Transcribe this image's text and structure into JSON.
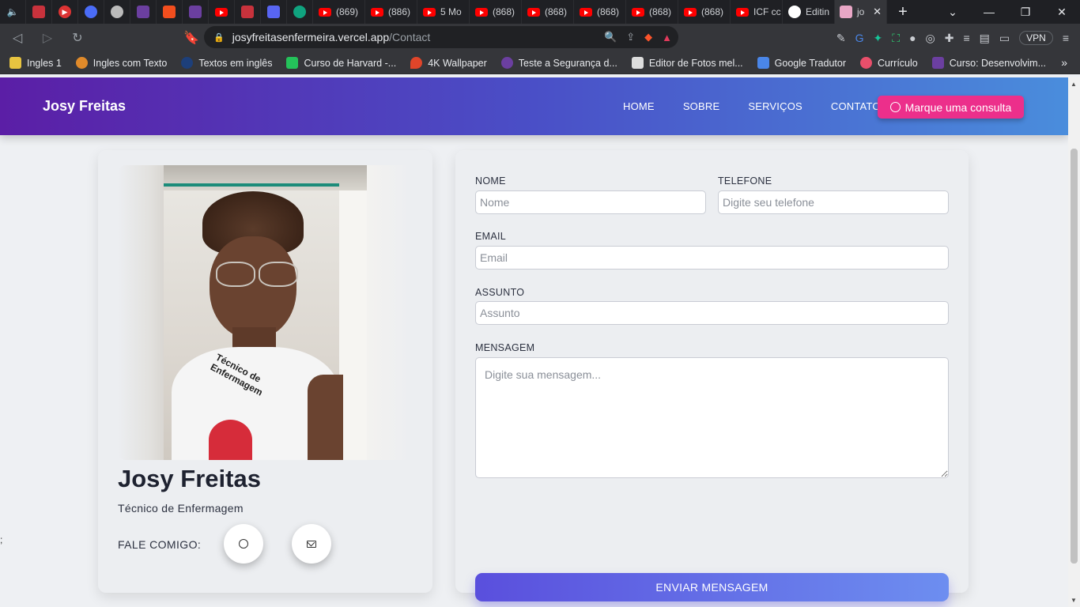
{
  "browser": {
    "tabs": [
      {
        "type": "icon",
        "color": "#f2f2f2",
        "icon": "speaker-icon"
      },
      {
        "type": "icon",
        "color": "#c8323c",
        "icon": "app-icon"
      },
      {
        "type": "icon",
        "color": "#d33",
        "icon": "play-icon"
      },
      {
        "type": "icon",
        "color": "#4a6cf7",
        "icon": "chrome-icon"
      },
      {
        "type": "icon",
        "color": "#bbb",
        "icon": "ball-icon"
      },
      {
        "type": "icon",
        "color": "#6b3fa0",
        "icon": "grid-icon"
      },
      {
        "type": "icon",
        "color": "#f24e1e",
        "icon": "figma-icon"
      },
      {
        "type": "icon",
        "color": "#6b3fa0",
        "icon": "grid-icon"
      },
      {
        "type": "icon",
        "color": "#ff0000",
        "icon": "youtube-icon"
      },
      {
        "type": "icon",
        "color": "#c8323c",
        "icon": "app-icon"
      },
      {
        "type": "icon",
        "color": "#5865f2",
        "icon": "chat-icon"
      },
      {
        "type": "icon",
        "color": "#10a37f",
        "icon": "openai-icon"
      }
    ],
    "yt_tabs": [
      "(869)",
      "(886)",
      "5 Mo",
      "(868)",
      "(868)",
      "(868)",
      "(868)",
      "(868)"
    ],
    "extra_tabs": [
      {
        "label": "ICF cc",
        "icon": "youtube-icon"
      },
      {
        "label": "Editin",
        "icon": "github-icon"
      }
    ],
    "active_tab": {
      "label": "jo",
      "close": "✕"
    },
    "new_tab": "+",
    "window_controls": [
      "⌄",
      "—",
      "❐",
      "✕"
    ],
    "url_host": "josyfreitasenfermeira.vercel.app",
    "url_path": "/Contact",
    "vpn_label": "VPN",
    "bookmarks": [
      {
        "label": "Ingles 1",
        "color": "#e8c440"
      },
      {
        "label": "Ingles com Texto",
        "color": "#e08a2a"
      },
      {
        "label": "Textos em inglês",
        "color": "#1d3f7a"
      },
      {
        "label": "Curso de Harvard -...",
        "color": "#24c25a"
      },
      {
        "label": "4K Wallpaper",
        "color": "#e0452a"
      },
      {
        "label": "Teste a Segurança d...",
        "color": "#6b3fa0"
      },
      {
        "label": "Editor de Fotos mel...",
        "color": "#dddddd"
      },
      {
        "label": "Google Tradutor",
        "color": "#4a86e8"
      },
      {
        "label": "Currículo",
        "color": "#e94f6b"
      },
      {
        "label": "Curso: Desenvolvim...",
        "color": "#6b3fa0"
      }
    ],
    "bookmarks_more": "»"
  },
  "site": {
    "brand": "Josy Freitas",
    "menu": [
      "HOME",
      "SOBRE",
      "SERVIÇOS",
      "CONTATO"
    ],
    "cta": "Marque uma consulta",
    "colors": {
      "nav_start": "#5b1ea6",
      "nav_end": "#4a8ddc",
      "cta": "#ec2f8b"
    }
  },
  "profile": {
    "name": "Josy Freitas",
    "role": "Técnico de Enfermagem",
    "contact_label": "FALE COMIGO:",
    "shirt_text": "Técnico de Enfermagem"
  },
  "form": {
    "nome_label": "NOME",
    "nome_placeholder": "Nome",
    "telefone_label": "TELEFONE",
    "telefone_placeholder": "Digite seu telefone",
    "email_label": "EMAIL",
    "email_placeholder": "Email",
    "assunto_label": "ASSUNTO",
    "assunto_placeholder": "Assunto",
    "mensagem_label": "MENSAGEM",
    "mensagem_placeholder": "Digite sua mensagem...",
    "submit": "ENVIAR MENSAGEM"
  },
  "stray_char": ";"
}
